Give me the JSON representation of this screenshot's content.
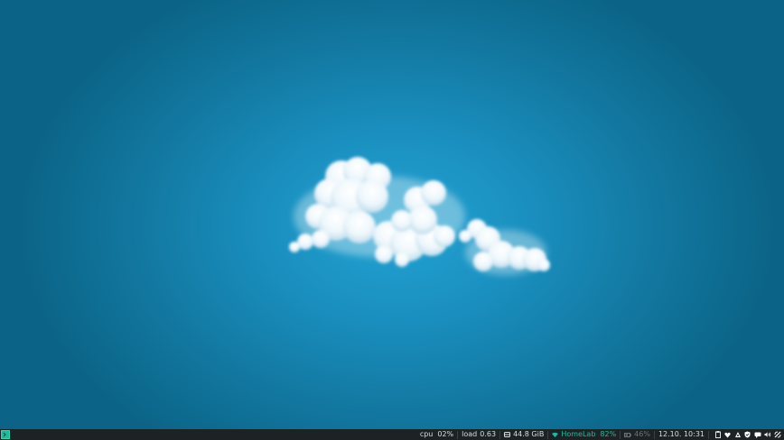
{
  "desktop": {
    "wallpaper": "cloud-on-blue-sky"
  },
  "colors": {
    "sky_center": "#22a3d3",
    "sky_edge": "#0b6487",
    "bar_background": "#1d2225",
    "bar_text": "#d8dde0",
    "accent": "#1abc9c",
    "muted": "#6b7478"
  },
  "taskbar": {
    "launcher_icon": "terminal-icon",
    "cpu": {
      "label": "cpu",
      "value": "02%"
    },
    "load": {
      "label": "load",
      "value": "0.63"
    },
    "disk": {
      "icon": "disk-icon",
      "value": "44.8 GiB"
    },
    "wifi": {
      "icon": "wifi-icon",
      "ssid": "HomeLab",
      "quality": "82%"
    },
    "battery": {
      "icon": "battery-icon",
      "value": "46%"
    },
    "clock": "12.10. 10:31",
    "tray_icons": [
      "clipboard-icon",
      "heart-icon",
      "steam-icon",
      "shield-icon",
      "chat-icon",
      "volume-icon",
      "connection-icon"
    ]
  }
}
